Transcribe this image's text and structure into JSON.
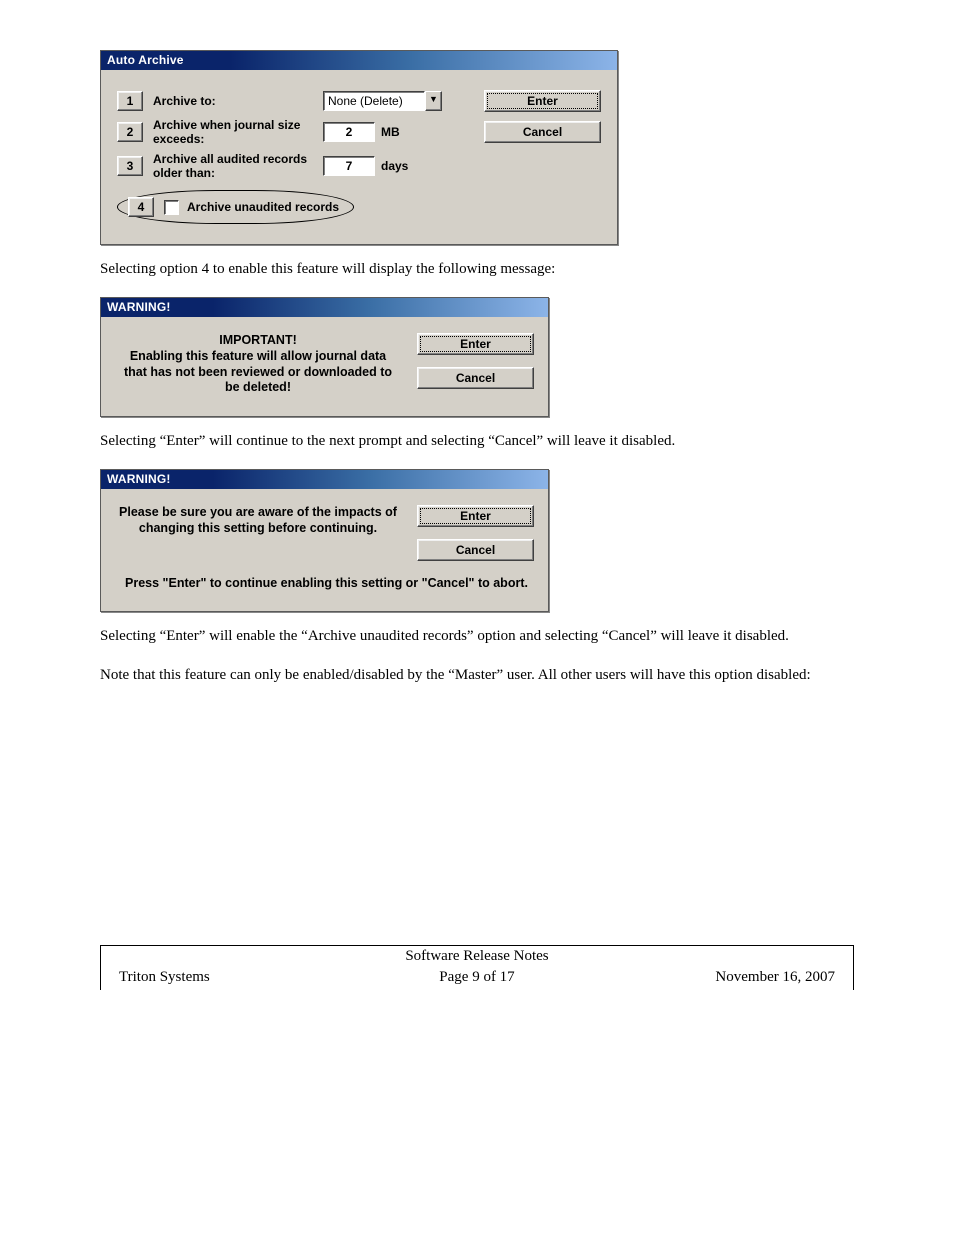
{
  "auto_archive": {
    "title": "Auto Archive",
    "rows": [
      {
        "num": "1",
        "label": "Archive to:",
        "dropdown": "None (Delete)"
      },
      {
        "num": "2",
        "label": "Archive when journal size exceeds:",
        "value": "2",
        "unit": "MB"
      },
      {
        "num": "3",
        "label": "Archive all audited records older than:",
        "value": "7",
        "unit": "days"
      }
    ],
    "row4": {
      "num": "4",
      "label": "Archive unaudited records"
    },
    "buttons": {
      "enter": "Enter",
      "cancel": "Cancel"
    }
  },
  "para1": "Selecting option 4 to enable this feature will display the following message:",
  "warning1": {
    "title": "WARNING!",
    "heading": "IMPORTANT!",
    "body": "Enabling this feature will allow journal data that has not been reviewed or downloaded to be deleted!",
    "enter": "Enter",
    "cancel": "Cancel"
  },
  "para2": "Selecting “Enter” will continue to the next prompt and selecting “Cancel” will leave it disabled.",
  "warning2": {
    "title": "WARNING!",
    "body1": "Please be sure you are aware of the impacts of changing this setting before continuing.",
    "body2": "Press \"Enter\" to continue enabling this setting or \"Cancel\" to abort.",
    "enter": "Enter",
    "cancel": "Cancel"
  },
  "para3": "Selecting “Enter” will enable the “Archive unaudited records” option and selecting “Cancel” will leave it disabled.",
  "para4": "Note that this feature can only be enabled/disabled by the “Master” user.  All other users will have this option disabled:",
  "footer": {
    "top": "Software Release Notes",
    "left": "Triton Systems",
    "center": "Page 9 of 17",
    "right": "November 16, 2007"
  }
}
